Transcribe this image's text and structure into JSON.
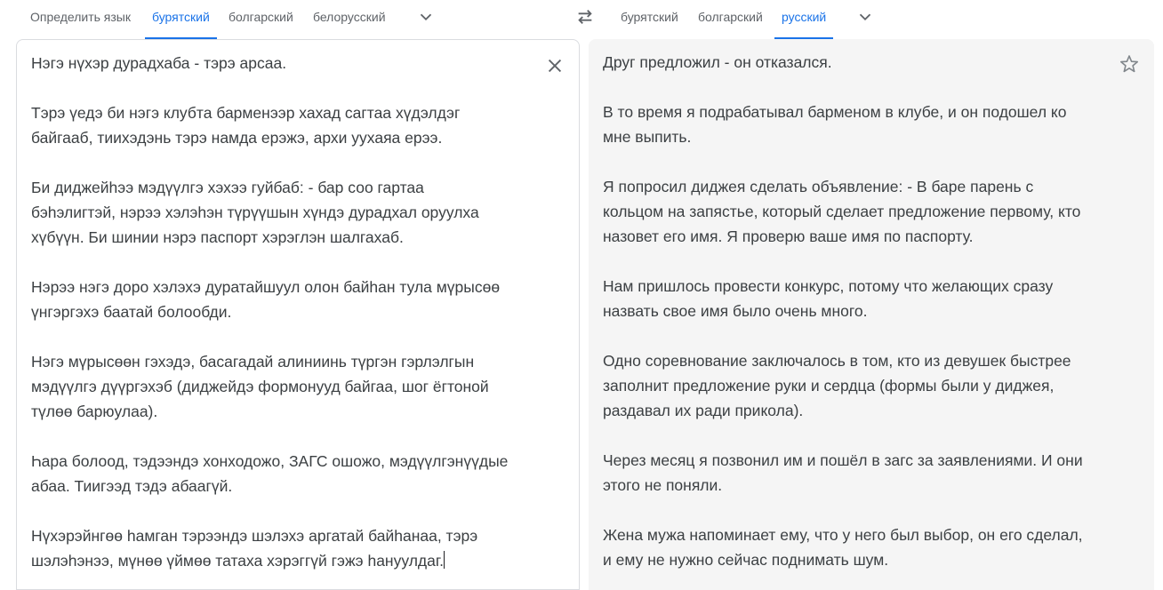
{
  "source_langs": {
    "detect": "Определить язык",
    "tab1": "бурятский",
    "tab2": "болгарский",
    "tab3": "белорусский"
  },
  "target_langs": {
    "tab1": "бурятский",
    "tab2": "болгарский",
    "tab3": "русский"
  },
  "icons": {
    "swap": "swap-arrows-icon",
    "source_more": "chevron-down-icon",
    "target_more": "chevron-down-icon",
    "clear": "close-icon",
    "save": "star-icon"
  },
  "colors": {
    "accent": "#1a73e8",
    "text": "#3c4043",
    "muted": "#5f6368",
    "target_bg": "#f5f5f5"
  },
  "source_text": "Нэгэ нүхэр дурадхаба - тэрэ арсаа.\n\nТэрэ үедэ би нэгэ клубта барменээр хахад сагтаа хүдэлдэг\nбайгааб, тиихэдэнь тэрэ намда ерэжэ, архи уухаяа ерээ.\n\nБи диджейһээ мэдүүлгэ хэхээ гуйбаб: - бар соо гартаа\nбэһэлигтэй, нэрээ хэлэһэн түрүүшын хүндэ дурадхал оруулха\nхүбүүн. Би шинии нэрэ паспорт хэрэглэн шалгахаб.\n\nНэрээ нэгэ доро хэлэхэ дуратайшуул олон байһан тула мүрысөө\nүнгэргэхэ баатай болообди.\n\nНэгэ мүрысөөн гэхэдэ, басагадай алиниинь түргэн гэрлэлгын\nмэдүүлгэ дүүргэхэб (диджейдэ формонууд байгаа, шог ёгтоной\nтүлөө барюулаа).\n\nҺара болоод, тэдээндэ хонходожо, ЗАГС ошожо, мэдүүлгэнүүдые\nабаа. Тиигээд тэдэ абаагүй.\n\nНүхэрэйнгөө һамган тэрээндэ шэлэхэ аргатай байһанаа, тэрэ\nшэлэһэнээ, мүнөө үймөө татаха хэрэггүй гэжэ һануулдаг.",
  "target_text": "Друг предложил - он отказался.\n\nВ то время я подрабатывал барменом в клубе, и он подошел ко\nмне выпить.\n\nЯ попросил диджея сделать объявление: - В баре парень с\nкольцом на запястье, который сделает предложение первому, кто\nназовет его имя. Я проверю ваше имя по паспорту.\n\nНам пришлось провести конкурс, потому что желающих сразу\nназвать свое имя было очень много.\n\nОдно соревнование заключалось в том, кто из девушек быстрее\nзаполнит предложение руки и сердца (формы были у диджея,\nраздавал их ради прикола).\n\nЧерез месяц я позвонил им и пошёл в загс за заявлениями. И они\nэтого не поняли.\n\nЖена мужа напоминает ему, что у него был выбор, он его сделал,\nи ему не нужно сейчас поднимать шум."
}
